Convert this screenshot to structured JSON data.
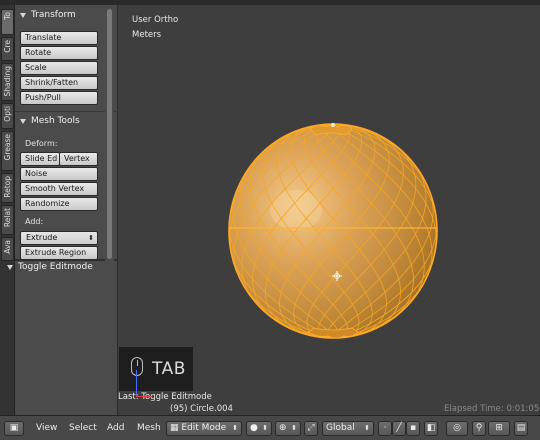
{
  "toolshelf": {
    "tabs": [
      "To",
      "Cre",
      "Shading",
      "Opti",
      "Grease",
      "Retop",
      "Relat",
      "Ava"
    ],
    "transform": {
      "title": "Transform",
      "buttons": [
        "Translate",
        "Rotate",
        "Scale",
        "Shrink/Fatten",
        "Push/Pull"
      ]
    },
    "mesh_tools": {
      "title": "Mesh Tools",
      "deform_label": "Deform:",
      "slide_edge": "Slide Ed",
      "vertex": "Vertex",
      "buttons": [
        "Noise",
        "Smooth Vertex",
        "Randomize"
      ],
      "add_label": "Add:",
      "extrude": "Extrude",
      "extrude_region": "Extrude Region"
    },
    "operator_panel": {
      "title": "Toggle Editmode"
    }
  },
  "viewport": {
    "view_label": "User Ortho",
    "units_label": "Meters",
    "last_operator": "Last: Toggle Editmode",
    "object_info": "(95) Circle.004",
    "elapsed": "Elapsed Time: 0:01:05",
    "mesh_color": "#f5a623",
    "object_color": "#d39a3f"
  },
  "keycast": {
    "key": "TAB",
    "icon": "mouse-icon"
  },
  "bottom_bar": {
    "menus": [
      "View",
      "Select",
      "Add",
      "Mesh"
    ],
    "mode": "Edit Mode",
    "orientation": "Global",
    "icons": [
      "editor-type-icon",
      "viewport-shading-icon",
      "pivot-point-icon",
      "manipulator-icon",
      "layers-icon",
      "snap-icon",
      "proportional-edit-icon"
    ]
  }
}
